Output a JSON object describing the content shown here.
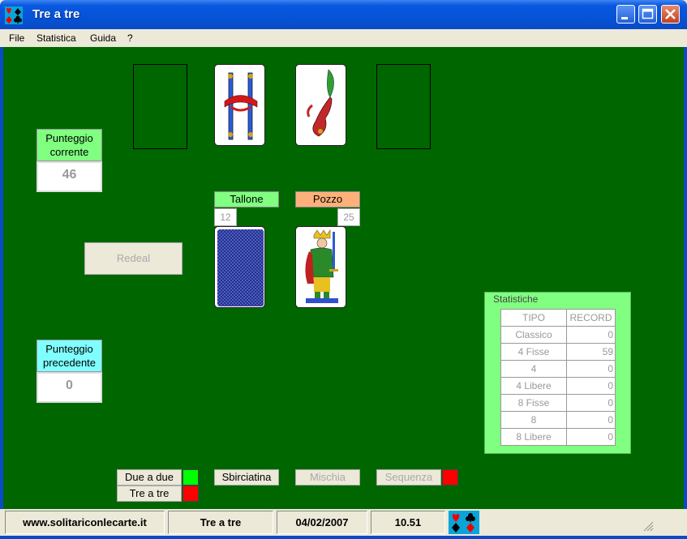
{
  "window": {
    "title": "Tre a tre",
    "app_icon": "card-suits-icon",
    "controls": [
      "minimize-icon",
      "maximize-icon",
      "close-icon"
    ]
  },
  "menu": [
    "File",
    "Statistica",
    "Guida",
    "?"
  ],
  "scores": {
    "current_label": "Punteggio\ncorrente",
    "current_value": "46",
    "previous_label": "Punteggio\nprecedente",
    "previous_value": "0"
  },
  "top_cards": [
    {
      "kind": "empty-slot"
    },
    {
      "kind": "card",
      "icon": "two-of-swords-card-icon"
    },
    {
      "kind": "card",
      "icon": "ace-of-clubs-card-icon"
    },
    {
      "kind": "empty-slot"
    }
  ],
  "piles": {
    "tallone_label": "Tallone",
    "tallone_count": "12",
    "tallone_icon": "card-back-icon",
    "pozzo_label": "Pozzo",
    "pozzo_count": "25",
    "pozzo_icon": "king-of-swords-card-icon"
  },
  "buttons": {
    "redeal": "Redeal",
    "due_a_due": "Due a due",
    "tre_a_tre": "Tre a tre",
    "sbirciatina": "Sbirciatina",
    "mischia": "Mischia",
    "sequenza": "Sequenza"
  },
  "statistics": {
    "title": "Statistiche",
    "headers": [
      "TIPO",
      "RECORD"
    ],
    "rows": [
      [
        "Classico",
        "0"
      ],
      [
        "4 Fisse",
        "59"
      ],
      [
        "4",
        "0"
      ],
      [
        "4 Libere",
        "0"
      ],
      [
        "8 Fisse",
        "0"
      ],
      [
        "8",
        "0"
      ],
      [
        "8 Libere",
        "0"
      ]
    ]
  },
  "status": {
    "site": "www.solitariconlecarte.it",
    "game": "Tre a tre",
    "date": "04/02/2007",
    "time": "10.51"
  },
  "colors": {
    "felt": "#006600",
    "label_green": "#80ff80",
    "label_orange": "#ffb07a",
    "label_cyan": "#80ffff",
    "indicator_on": "#00ff00",
    "indicator_off": "#ff0000"
  }
}
